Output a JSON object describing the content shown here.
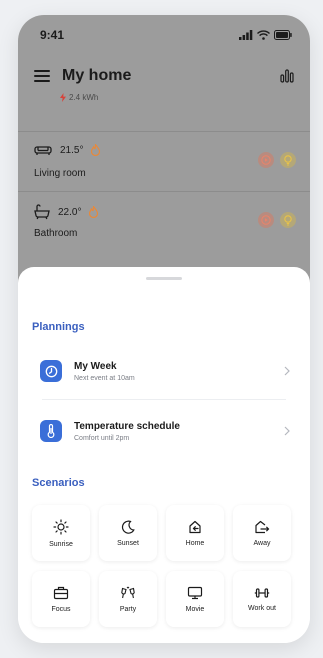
{
  "status_bar": {
    "time": "9:41"
  },
  "header": {
    "title": "My home",
    "energy": "2.4 kWh"
  },
  "rooms": [
    {
      "name": "Living room",
      "temperature": "21.5°"
    },
    {
      "name": "Bathroom",
      "temperature": "22.0°"
    }
  ],
  "plannings": {
    "title": "Plannings",
    "items": [
      {
        "title": "My Week",
        "subtitle": "Next event at 10am",
        "icon": "clock-icon"
      },
      {
        "title": "Temperature schedule",
        "subtitle": "Comfort until 2pm",
        "icon": "thermometer-icon"
      }
    ]
  },
  "scenarios": {
    "title": "Scenarios",
    "items": [
      {
        "label": "Sunrise",
        "icon": "sun-icon"
      },
      {
        "label": "Sunset",
        "icon": "moon-icon"
      },
      {
        "label": "Home",
        "icon": "home-arrive-icon"
      },
      {
        "label": "Away",
        "icon": "home-leave-icon"
      },
      {
        "label": "Focus",
        "icon": "briefcase-icon"
      },
      {
        "label": "Party",
        "icon": "glasses-icon"
      },
      {
        "label": "Movie",
        "icon": "monitor-icon"
      },
      {
        "label": "Work out",
        "icon": "dumbbell-icon"
      }
    ]
  },
  "colors": {
    "accent": "#3a5fbf",
    "plan_icon_bg": "#3a6ed8",
    "flame": "#e8893a",
    "action_play": "#e9846a",
    "action_light": "#e8c24a",
    "overlay": "#9c9c9c"
  }
}
